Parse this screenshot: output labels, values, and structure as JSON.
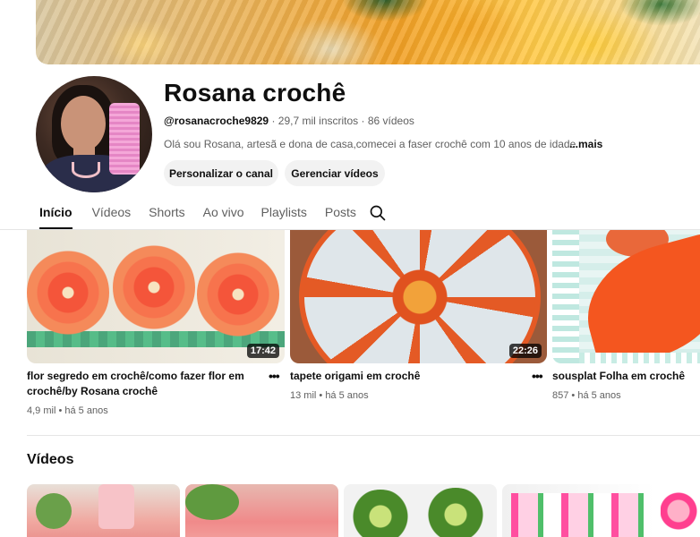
{
  "channel": {
    "title": "Rosana crochê",
    "handle": "@rosanacroche9829",
    "subscribers": "29,7 mil inscritos",
    "videos_count": "86 vídeos",
    "description": "Olá sou Rosana, artesã e dona de casa,comecei a faser crochê com 10 anos de idade.nao",
    "more_label": "...mais"
  },
  "actions": {
    "customize": "Personalizar o canal",
    "manage": "Gerenciar vídeos"
  },
  "tabs": [
    {
      "label": "Início",
      "active": true
    },
    {
      "label": "Vídeos",
      "active": false
    },
    {
      "label": "Shorts",
      "active": false
    },
    {
      "label": "Ao vivo",
      "active": false
    },
    {
      "label": "Playlists",
      "active": false
    },
    {
      "label": "Posts",
      "active": false
    }
  ],
  "featured": [
    {
      "title": "flor segredo em crochê/como fazer flor em crochê/by Rosana crochê",
      "duration": "17:42",
      "views": "4,9 mil",
      "age": "há 5 anos"
    },
    {
      "title": "tapete origami em crochê",
      "duration": "22:26",
      "views": "13 mil",
      "age": "há 5 anos"
    },
    {
      "title": "sousplat Folha em crochê",
      "duration": "",
      "views": "857",
      "age": "há 5 anos"
    }
  ],
  "videos_section": {
    "title": "Vídeos"
  },
  "colors": {
    "text": "#0f0f0f",
    "secondary": "#606060",
    "button_bg": "#f2f2f2"
  }
}
